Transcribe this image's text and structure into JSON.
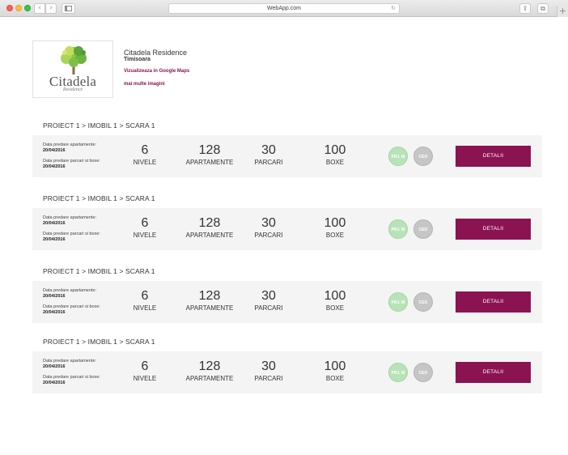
{
  "browser": {
    "address": "WebApp.com",
    "back_icon": "‹",
    "forward_icon": "›",
    "reload_icon": "↻",
    "share_icon": "⇪",
    "tabs_icon": "⧉",
    "plus_icon": "+"
  },
  "residence": {
    "logo_word": "Citadela",
    "logo_sub": "Residence",
    "name": "Citadela Residence",
    "city": "Timisoara",
    "maps_link": "Vizualizeaza in Google Maps",
    "more_images": "mai multe imagini"
  },
  "colors": {
    "accent": "#8c1352",
    "badge_pm": "#b8e3b8",
    "badge_ceo": "#c6c6c6",
    "row_bg": "#f4f4f4"
  },
  "projects": [
    {
      "breadcrumb": "PROIECT 1 > IMOBIL 1 > SCARA 1",
      "apt_label": "Data predare apartamente:",
      "apt_date": "20/04/2016",
      "park_label": "Data predare parcari si boxe:",
      "park_date": "20/04/2016",
      "niveles": "6",
      "niveles_label": "NIVELE",
      "apartments": "128",
      "apartments_label": "APARTAMENTE",
      "parking": "30",
      "parking_label": "PARCARI",
      "boxes": "100",
      "boxes_label": "BOXE",
      "badge_pm": "PRJ. M",
      "badge_ceo": "CEO",
      "button": "DETALII"
    },
    {
      "breadcrumb": "PROIECT 1 > IMOBIL 1 > SCARA 1",
      "apt_label": "Data predare apartamente:",
      "apt_date": "20/04/2016",
      "park_label": "Data predare parcari si boxe:",
      "park_date": "20/04/2016",
      "niveles": "6",
      "niveles_label": "NIVELE",
      "apartments": "128",
      "apartments_label": "APARTAMENTE",
      "parking": "30",
      "parking_label": "PARCARI",
      "boxes": "100",
      "boxes_label": "BOXE",
      "badge_pm": "PRJ. M",
      "badge_ceo": "CEO",
      "button": "DETALII"
    },
    {
      "breadcrumb": "PROIECT 1 > IMOBIL 1 > SCARA 1",
      "apt_label": "Data predare apartamente:",
      "apt_date": "20/04/2016",
      "park_label": "Data predare parcari si boxe:",
      "park_date": "20/04/2016",
      "niveles": "6",
      "niveles_label": "NIVELE",
      "apartments": "128",
      "apartments_label": "APARTAMENTE",
      "parking": "30",
      "parking_label": "PARCARI",
      "boxes": "100",
      "boxes_label": "BOXE",
      "badge_pm": "PRJ. M",
      "badge_ceo": "CEO",
      "button": "DETALII"
    },
    {
      "breadcrumb": "PROIECT 1 > IMOBIL 1 > SCARA 1",
      "apt_label": "Data predare apartamente:",
      "apt_date": "20/04/2016",
      "park_label": "Data predare parcari si boxe:",
      "park_date": "20/04/2016",
      "niveles": "6",
      "niveles_label": "NIVELE",
      "apartments": "128",
      "apartments_label": "APARTAMENTE",
      "parking": "30",
      "parking_label": "PARCARI",
      "boxes": "100",
      "boxes_label": "BOXE",
      "badge_pm": "PRJ. M",
      "badge_ceo": "CEO",
      "button": "DETALII"
    }
  ]
}
